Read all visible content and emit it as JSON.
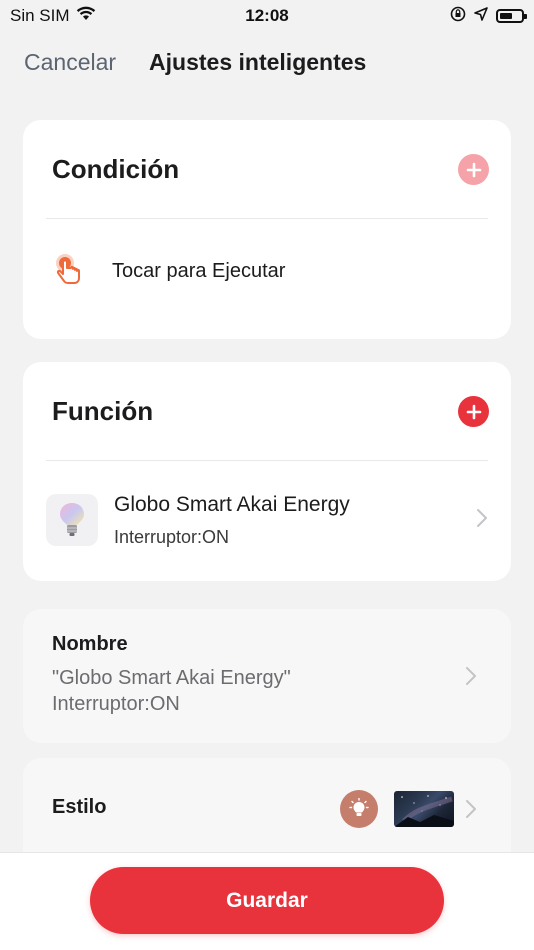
{
  "status_bar": {
    "carrier": "Sin SIM",
    "time": "12:08"
  },
  "nav": {
    "cancel_label": "Cancelar",
    "title": "Ajustes inteligentes"
  },
  "condition": {
    "title": "Condición",
    "item_label": "Tocar para Ejecutar"
  },
  "function": {
    "title": "Función",
    "device_name": "Globo Smart Akai Energy",
    "device_state": "Interruptor:ON"
  },
  "name_section": {
    "label": "Nombre",
    "value_line1": "\"Globo Smart Akai Energy\"",
    "value_line2": "Interruptor:ON"
  },
  "style_section": {
    "label": "Estilo"
  },
  "footer": {
    "save_label": "Guardar"
  },
  "colors": {
    "accent": "#e8323c",
    "accent_light": "#f5a3a8",
    "hand_icon": "#ef6a3a",
    "style_icon_bg": "#c47e6b"
  }
}
